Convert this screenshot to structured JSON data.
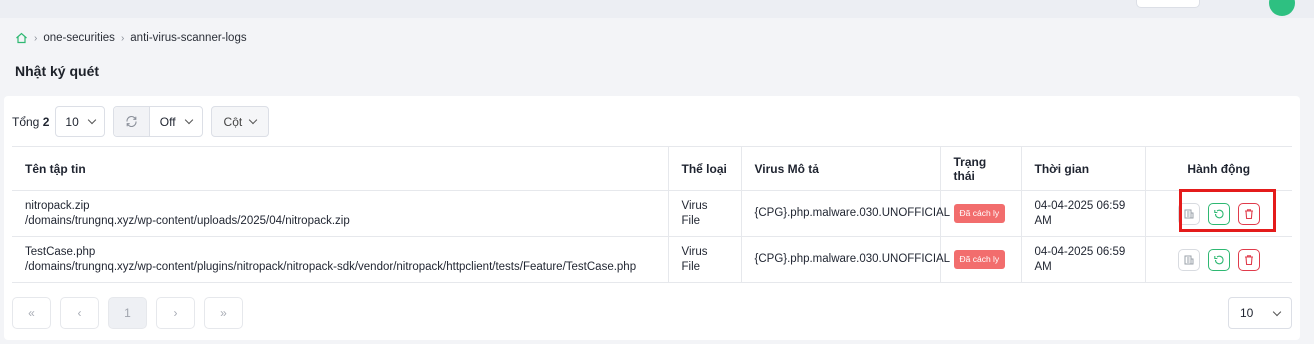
{
  "breadcrumb": {
    "items": [
      "one-securities",
      "anti-virus-scanner-logs"
    ]
  },
  "page": {
    "title": "Nhật ký quét"
  },
  "toolbar": {
    "total_label": "Tổng",
    "total_count": "2",
    "page_size": "10",
    "refresh_interval": "Off",
    "columns_label": "Cột"
  },
  "table": {
    "headers": [
      "Tên tập tin",
      "Thể loại",
      "Virus Mô tả",
      "Trạng thái",
      "Thời gian",
      "Hành động"
    ],
    "rows": [
      {
        "name": "nitropack.zip",
        "path": "/domains/trungnq.xyz/wp-content/uploads/2025/04/nitropack.zip",
        "type": "Virus File",
        "virus": "{CPG}.php.malware.030.UNOFFICIAL",
        "status": "Đã cách ly",
        "time": "04-04-2025 06:59 AM"
      },
      {
        "name": "TestCase.php",
        "path": "/domains/trungnq.xyz/wp-content/plugins/nitropack/nitropack-sdk/vendor/nitropack/httpclient/tests/Feature/TestCase.php",
        "type": "Virus File",
        "virus": "{CPG}.php.malware.030.UNOFFICIAL",
        "status": "Đã cách ly",
        "time": "04-04-2025 06:59 AM"
      }
    ]
  },
  "pagination": {
    "first": "«",
    "prev": "‹",
    "current": "1",
    "next": "›",
    "last": "»",
    "page_size": "10"
  },
  "icons": {
    "home": "home-icon",
    "refresh": "refresh-icon",
    "detail": "file-detail-icon",
    "restore": "restore-icon",
    "delete": "trash-icon"
  },
  "colors": {
    "badge": "#f26d6d",
    "restore": "#2eb872",
    "delete": "#e03b4b",
    "highlight": "#e41b1b"
  }
}
